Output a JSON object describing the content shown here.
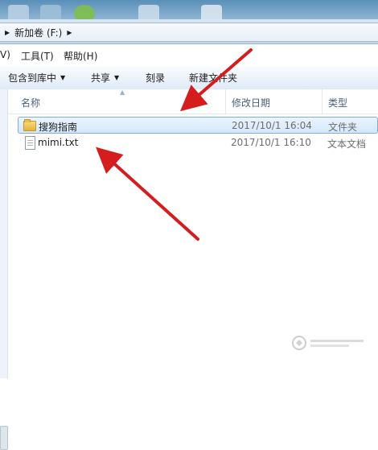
{
  "address_bar": {
    "path": "新加卷 (F:)"
  },
  "menu": {
    "items": [
      "V)",
      "工具(T)",
      "帮助(H)"
    ]
  },
  "toolbar": {
    "include_library": "包含到库中",
    "share": "共享",
    "burn": "刻录",
    "new_folder": "新建文件夹"
  },
  "columns": {
    "name": "名称",
    "modified": "修改日期",
    "type": "类型"
  },
  "files": [
    {
      "name": "搜狗指南",
      "modified": "2017/10/1 16:04",
      "type": "文件夹",
      "icon": "folder-icon",
      "selected": true
    },
    {
      "name": "mimi.txt",
      "modified": "2017/10/1 16:10",
      "type": "文本文档",
      "icon": "text-file-icon",
      "selected": false
    }
  ],
  "colors": {
    "arrow": "#d61d1d",
    "selection": "#d3e8fc",
    "selection_border": "#84acdd"
  }
}
